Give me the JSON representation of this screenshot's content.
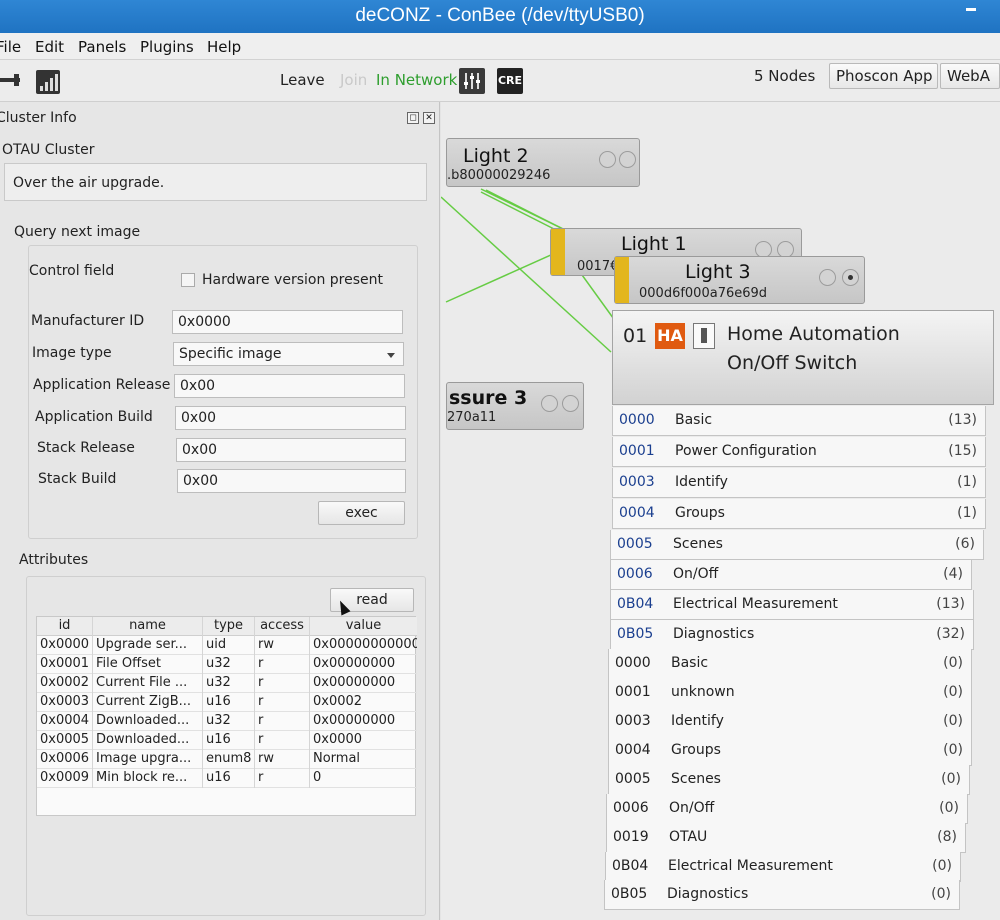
{
  "window": {
    "title": "deCONZ - ConBee (/dev/ttyUSB0)"
  },
  "menu": {
    "items": [
      "File",
      "Edit",
      "Panels",
      "Plugins",
      "Help"
    ]
  },
  "toolbar": {
    "leave": "Leave",
    "join": "Join",
    "in_network": "In Network",
    "cre_icon": "CRE",
    "nodes_count": "5 Nodes",
    "phoscon_app": "Phoscon App",
    "webapp": "WebA"
  },
  "cluster_info": {
    "panel_title": "Cluster Info",
    "cluster_name": "OTAU Cluster",
    "description": "Over the air upgrade.",
    "query_title": "Query next image",
    "control_field_label": "Control field",
    "hw_version_label": "Hardware version present",
    "fields": [
      {
        "label": "Manufacturer ID",
        "value": "0x0000"
      },
      {
        "label": "Image type",
        "value": "Specific image"
      },
      {
        "label": "Application Release",
        "value": "0x00"
      },
      {
        "label": "Application Build",
        "value": "0x00"
      },
      {
        "label": "Stack Release",
        "value": "0x00"
      },
      {
        "label": "Stack Build",
        "value": "0x00"
      }
    ],
    "exec_label": "exec",
    "attributes_title": "Attributes",
    "read_label": "read"
  },
  "attributes": {
    "columns": [
      "id",
      "name",
      "type",
      "access",
      "value"
    ],
    "rows": [
      [
        "0x0000",
        "Upgrade ser...",
        "uid",
        "rw",
        "0x00000000000"
      ],
      [
        "0x0001",
        "File Offset",
        "u32",
        "r",
        "0x00000000"
      ],
      [
        "0x0002",
        "Current File ...",
        "u32",
        "r",
        "0x00000000"
      ],
      [
        "0x0003",
        "Current ZigB...",
        "u16",
        "r",
        "0x0002"
      ],
      [
        "0x0004",
        "Downloaded...",
        "u32",
        "r",
        "0x00000000"
      ],
      [
        "0x0005",
        "Downloaded...",
        "u16",
        "r",
        "0x0000"
      ],
      [
        "0x0006",
        "Image upgra...",
        "enum8",
        "rw",
        "Normal"
      ],
      [
        "0x0009",
        "Min block re...",
        "u16",
        "r",
        "0"
      ]
    ]
  },
  "nodes": {
    "light2": {
      "name": "Light 2",
      "addr": ".b80000029246"
    },
    "light1": {
      "name": "Light 1",
      "addr": "0017€"
    },
    "light3": {
      "name": "Light 3",
      "addr": "000d6f000a76e69d"
    },
    "pressure3": {
      "name": "ssure 3",
      "addr": "270a11"
    }
  },
  "endpoint": {
    "number": "01",
    "profile_icon": "HA",
    "profile": "Home Automation",
    "device": "On/Off Switch",
    "server_clusters": [
      {
        "id": "0000",
        "name": "Basic",
        "count": "(13)"
      },
      {
        "id": "0001",
        "name": "Power Configuration",
        "count": "(15)"
      },
      {
        "id": "0003",
        "name": "Identify",
        "count": "(1)"
      },
      {
        "id": "0004",
        "name": "Groups",
        "count": "(1)"
      },
      {
        "id": "0005",
        "name": "Scenes",
        "count": "(6)"
      },
      {
        "id": "0006",
        "name": "On/Off",
        "count": "(4)"
      },
      {
        "id": "0B04",
        "name": "Electrical Measurement",
        "count": "(13)"
      },
      {
        "id": "0B05",
        "name": "Diagnostics",
        "count": "(32)"
      }
    ],
    "client_clusters": [
      {
        "id": "0000",
        "name": "Basic",
        "count": "(0)"
      },
      {
        "id": "0001",
        "name": "unknown",
        "count": "(0)"
      },
      {
        "id": "0003",
        "name": "Identify",
        "count": "(0)"
      },
      {
        "id": "0004",
        "name": "Groups",
        "count": "(0)"
      },
      {
        "id": "0005",
        "name": "Scenes",
        "count": "(0)"
      },
      {
        "id": "0006",
        "name": "On/Off",
        "count": "(0)"
      },
      {
        "id": "0019",
        "name": "OTAU",
        "count": "(8)"
      },
      {
        "id": "0B04",
        "name": "Electrical Measurement",
        "count": "(0)"
      },
      {
        "id": "0B05",
        "name": "Diagnostics",
        "count": "(0)"
      }
    ]
  },
  "colors": {
    "link": "#66cc44",
    "titlebar": "#2378c8",
    "in_network": "#2e9e2e",
    "ha_badge": "#e05a10",
    "node_bar": "#e3b61d"
  }
}
